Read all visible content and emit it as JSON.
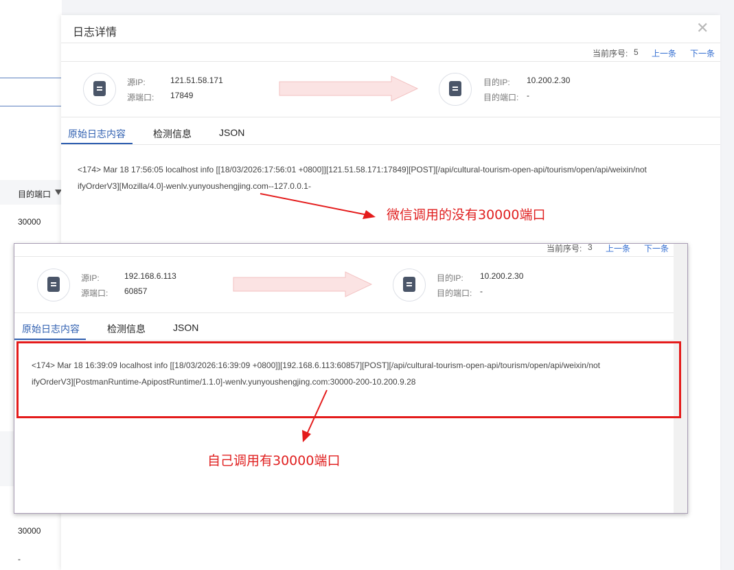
{
  "background": {
    "col_header": "目的端口",
    "row_values": [
      "30000",
      "30000",
      "-"
    ],
    "col_header_cut": "口"
  },
  "drawer": {
    "title": "日志详情",
    "close_icon": "close-icon",
    "nav": {
      "seq_label": "当前序号:",
      "seq_value": "5",
      "prev": "上一条",
      "next": "下一条"
    },
    "source": {
      "ip_label": "源IP:",
      "ip": "121.51.58.171",
      "port_label": "源端口:",
      "port": "17849"
    },
    "dest": {
      "ip_label": "目的IP:",
      "ip": "10.200.2.30",
      "port_label": "目的端口:",
      "port": "-"
    },
    "tabs": [
      "原始日志内容",
      "检测信息",
      "JSON"
    ],
    "active_tab": 0,
    "log_line1": "<174> Mar 18 17:56:05 localhost info [[18/03/2026:17:56:01 +0800]][121.51.58.171:17849][POST][/api/cultural-tourism-open-api/tourism/open/api/weixin/not",
    "log_line2": "ifyOrderV3][Mozilla/4.0]-wenlv.yunyoushengjing.com--127.0.0.1-"
  },
  "annotation1": "微信调用的没有30000端口",
  "second": {
    "nav": {
      "seq_label": "当前序号:",
      "seq_value": "3",
      "prev": "上一条",
      "next": "下一条"
    },
    "source": {
      "ip_label": "源IP:",
      "ip": "192.168.6.113",
      "port_label": "源端口:",
      "port": "60857"
    },
    "dest": {
      "ip_label": "目的IP:",
      "ip": "10.200.2.30",
      "port_label": "目的端口:",
      "port": "-"
    },
    "tabs": [
      "原始日志内容",
      "检测信息",
      "JSON"
    ],
    "log_line1": "<174> Mar 18 16:39:09 localhost info [[18/03/2026:16:39:09 +0800]][192.168.6.113:60857][POST][/api/cultural-tourism-open-api/tourism/open/api/weixin/not",
    "log_line2": "ifyOrderV3][PostmanRuntime-ApipostRuntime/1.1.0]-wenlv.yunyoushengjing.com:30000-200-10.200.9.28"
  },
  "annotation2": "自己调用有30000端口",
  "colors": {
    "accent": "#2f5fb0",
    "annotation": "#e41b1b"
  }
}
